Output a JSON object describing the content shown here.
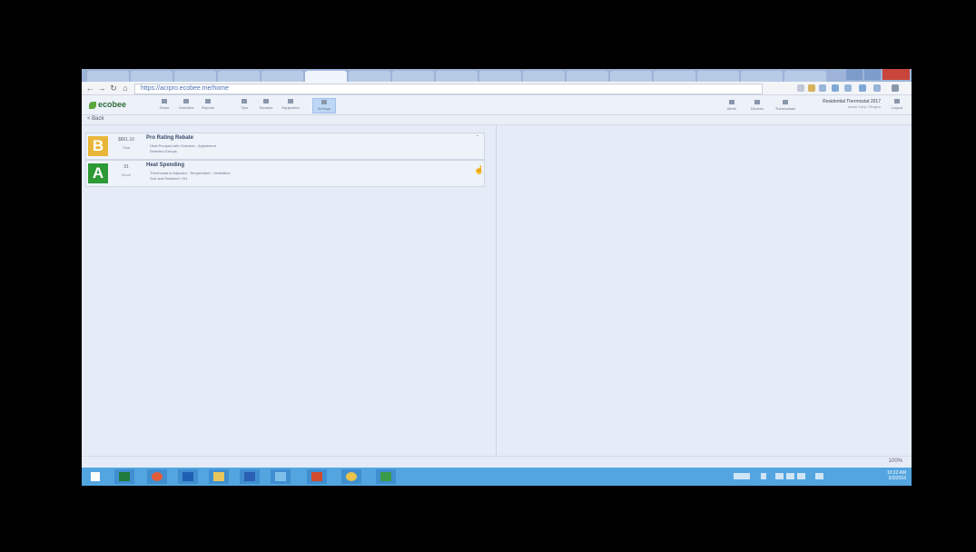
{
  "browser": {
    "url": "https://acrpro.ecobee.me/home"
  },
  "app": {
    "logo_text": "ecobee",
    "nav": [
      {
        "label": "Home",
        "icon": "home-icon"
      },
      {
        "label": "Overview",
        "icon": "chart-icon"
      },
      {
        "label": "Reports",
        "icon": "report-icon"
      },
      {
        "label": "Tips",
        "icon": "bulb-icon"
      },
      {
        "label": "Sensors",
        "icon": "sensor-icon"
      },
      {
        "label": "Equipment",
        "icon": "equipment-icon"
      },
      {
        "label": "Settings",
        "icon": "gear-icon"
      }
    ],
    "tools": [
      {
        "label": "Alerts",
        "icon": "bell-icon"
      },
      {
        "label": "Devices",
        "icon": "devices-icon"
      },
      {
        "label": "Thermostats",
        "icon": "thermostat-icon"
      }
    ],
    "user_name": "Residential Thermostat 2017",
    "user_role": "Acme Corp / Region",
    "logout_label": "Logout"
  },
  "subheader": {
    "back_label": "< Back"
  },
  "cards": [
    {
      "grade": "B",
      "score": "$861.10",
      "score_label": "Total",
      "title": "Pro Rating Rebate",
      "line1": "Heat Pumped with Oversize - Adjustment",
      "line2": "Selected Groups"
    },
    {
      "grade": "A",
      "score": "91",
      "score_label": "Score",
      "title": "Heat Spending",
      "line1": "Thermostat is Adjusted - Temperature - Ventilation",
      "line2": "Sort and Resident / 911"
    }
  ],
  "status": {
    "zoom": "100%"
  },
  "taskbar": {
    "apps": [
      "start-icon",
      "calendar-icon",
      "chrome-icon",
      "outlook-icon",
      "folder-icon",
      "word-icon",
      "browser-icon",
      "powerpoint-icon",
      "paint-icon",
      "phone-icon"
    ],
    "time": "10:22 AM",
    "date": "3/3/2016"
  },
  "colors": {
    "grade_b": "#e8b73a",
    "grade_a": "#2e9a36",
    "taskbar": "#53a5e0",
    "logo": "#5aa63f"
  }
}
